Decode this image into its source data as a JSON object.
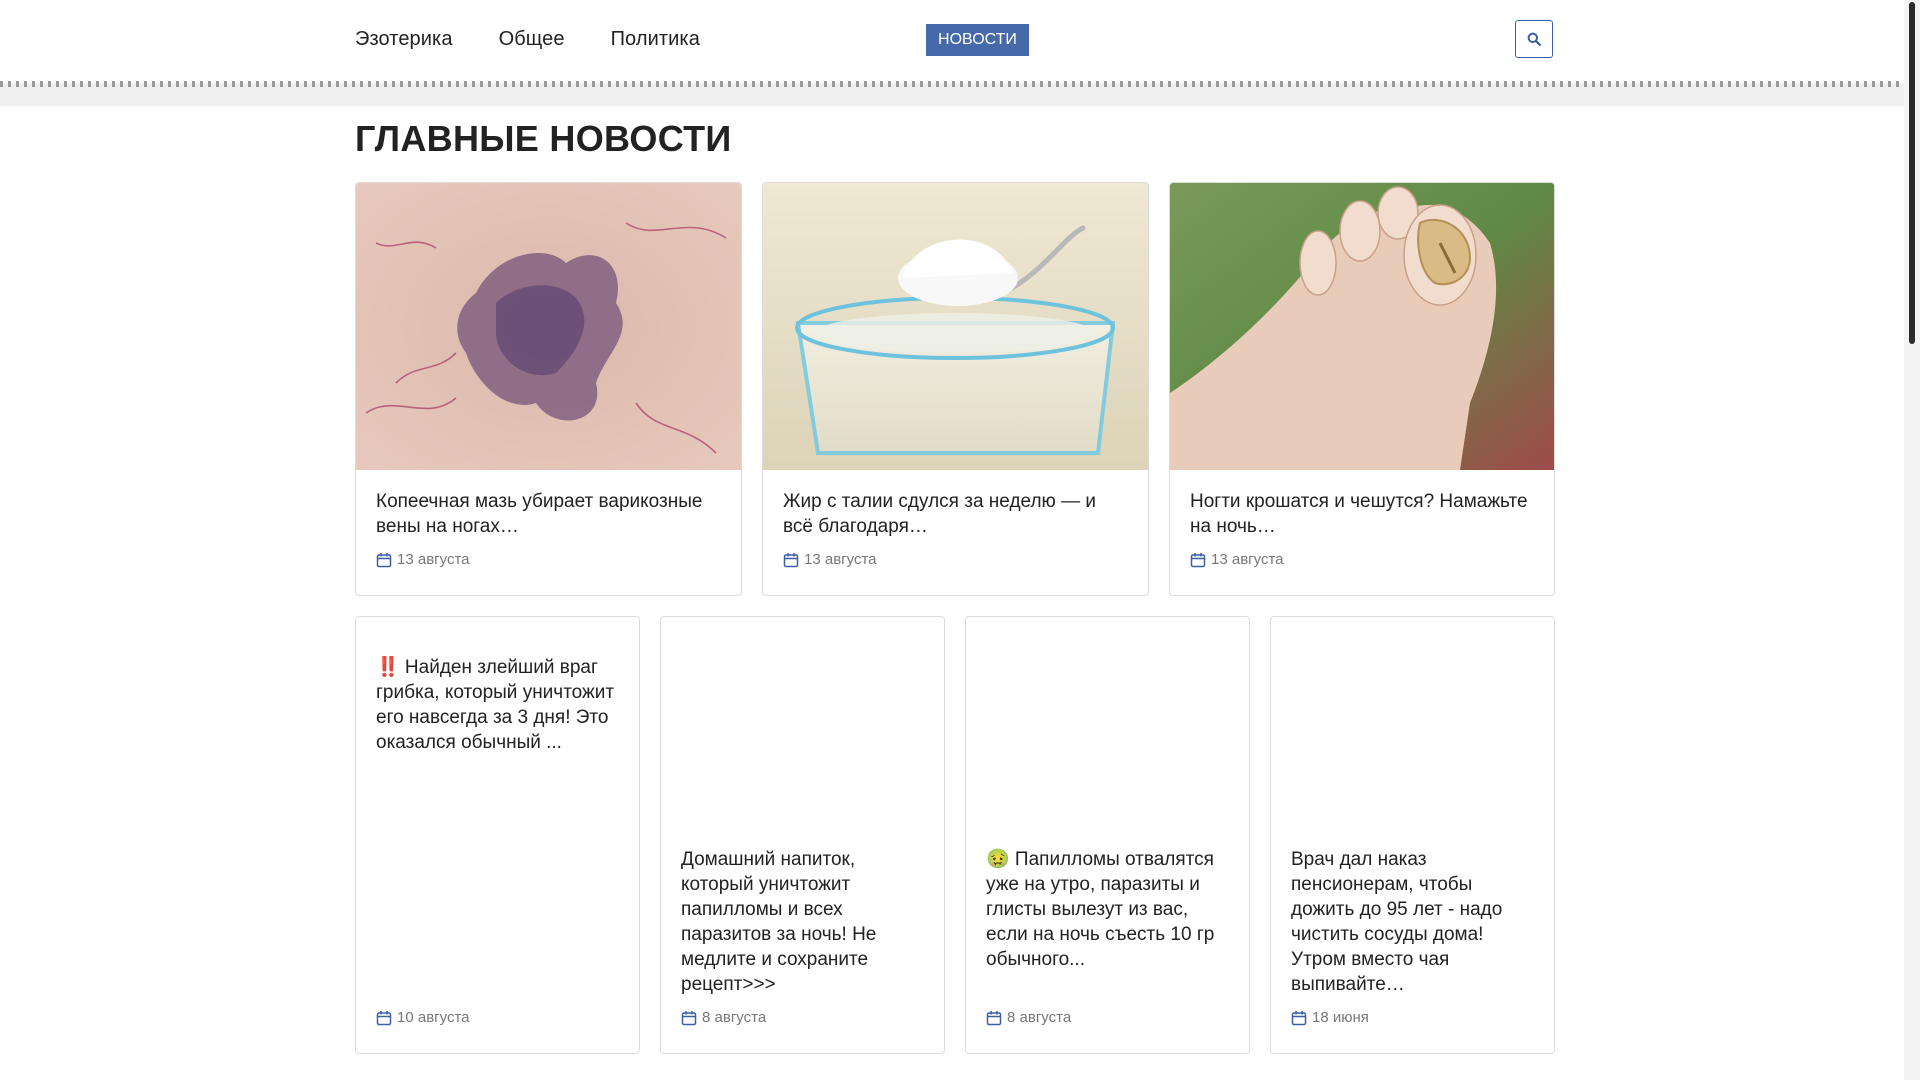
{
  "nav": {
    "items": [
      "Эзотерика",
      "Общее",
      "Политика"
    ],
    "news_badge": "НОВОСТИ",
    "search_icon": "search-icon"
  },
  "main": {
    "heading": "ГЛАВНЫЕ НОВОСТИ",
    "featured": [
      {
        "title": "Копеечная мазь убирает варикозные вены на ногах…",
        "date": "13 августа",
        "image": "varicose-veins-photo"
      },
      {
        "title": "Жир с талии сдулся за неделю — и всё благодаря…",
        "date": "13 августа",
        "image": "glass-with-spoon-photo"
      },
      {
        "title": "Ногти крошатся и чешутся? Намажьте на ночь…",
        "date": "13 августа",
        "image": "toenail-photo"
      }
    ],
    "small": [
      {
        "title": "‼️ Найден злейший враг грибка, который уничтожит его навсегда за 3 дня! Это оказался обычный ...",
        "date": "10 августа"
      },
      {
        "title": "Домашний напиток, который уничтожит папилломы и всех паразитов за ночь! Не медлите и сохраните рецепт>>>",
        "date": "8 августа"
      },
      {
        "title": "🤢 Папилломы отвалятся уже на утро, паразиты и глисты вылезут из вас, если на ночь съесть 10 гр обычного...",
        "date": "8 августа"
      },
      {
        "title": "Врач дал наказ пенсионерам, чтобы дожить до 95 лет - надо чистить сосуды дома! Утром вместо чая выпивайте…",
        "date": "18 июня"
      }
    ]
  },
  "colors": {
    "accent": "#4669a9",
    "calendar_icon": "#3a5ea8"
  }
}
